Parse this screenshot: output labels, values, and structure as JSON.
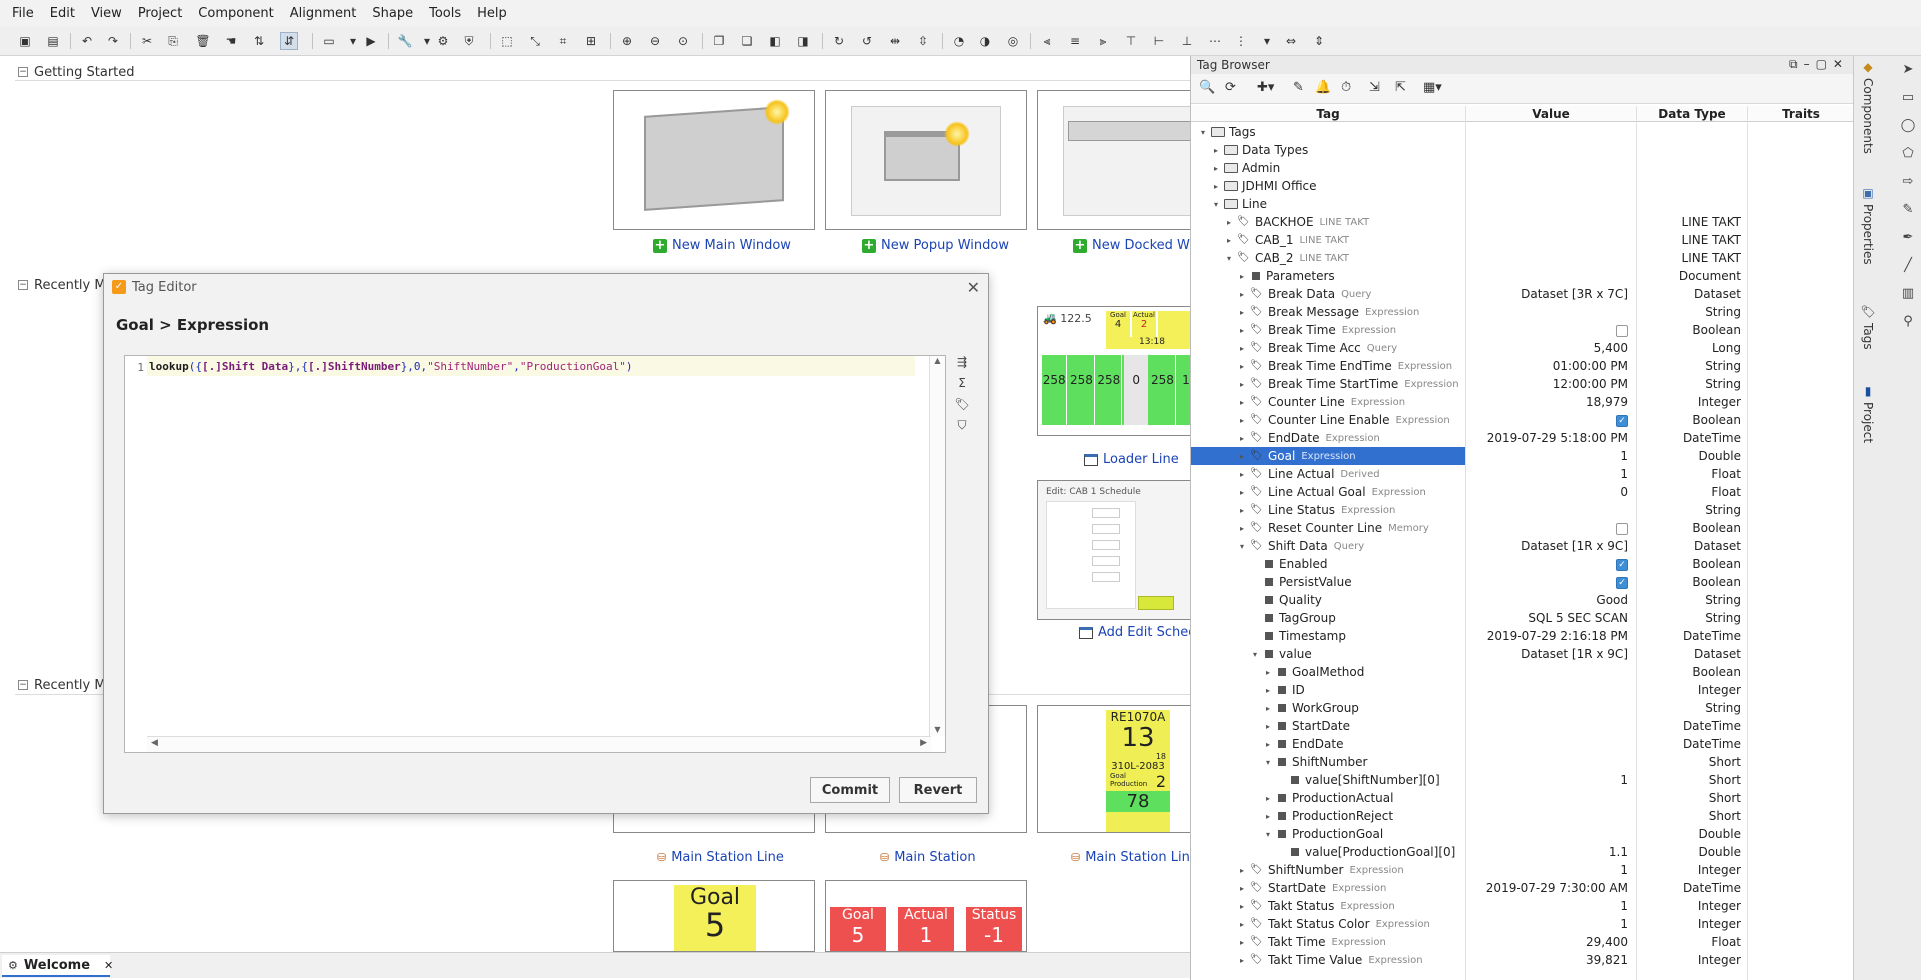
{
  "menu": [
    "File",
    "Edit",
    "View",
    "Project",
    "Component",
    "Alignment",
    "Shape",
    "Tools",
    "Help"
  ],
  "sections": {
    "getting_started": "Getting Started",
    "recently_modified_1": "Recently Mo",
    "recently_modified_2": "Recently Mo"
  },
  "cards": {
    "new_main_window": "New Main Window",
    "new_popup_window": "New Popup Window",
    "new_docked_window": "New Docked Windo",
    "loader_line": "Loader Line",
    "add_edit_schedule": "Add Edit Schedu",
    "main_station_line_1": "Main Station Line",
    "main_station": "Main Station",
    "main_station_line_2": "Main Station Line"
  },
  "thumbs": {
    "goal_label": "Goal",
    "goal_value": "5",
    "actual_label": "Actual",
    "actual_value": "1",
    "status_label": "Status",
    "status_value": "-1",
    "re_title": "RE1070A",
    "re_big": "13",
    "re_small": "18",
    "re_part": "310L-2083",
    "re_two": "2",
    "re_78": "78",
    "re_goal_caption": "Goal Production",
    "edit_schedule_title": "Edit: CAB 1 Schedule",
    "loader_goal": "Goal",
    "loader_actual": "Actual",
    "loader_four": "4",
    "loader_two": "2",
    "loader_clock": "13:18",
    "loader_1225": "122.5"
  },
  "dialog": {
    "title": "Tag Editor",
    "breadcrumb": "Goal > Expression",
    "line_no": "1",
    "code_fn": "lookup",
    "code_a": "({",
    "code_ref1": "[.]Shift Data",
    "code_b": "},{",
    "code_ref2": "[.]ShiftNumber",
    "code_c": "},0,",
    "code_s1": "\"ShiftNumber\"",
    "code_d": ",",
    "code_s2": "\"ProductionGoal\"",
    "code_e": ")",
    "commit": "Commit",
    "revert": "Revert"
  },
  "welcome_tab": "Welcome",
  "tag_browser": {
    "title": "Tag Browser",
    "columns": {
      "tag": "Tag",
      "value": "Value",
      "datatype": "Data Type",
      "traits": "Traits"
    },
    "rows": [
      {
        "indent": 0,
        "arrow": "▾",
        "icon": "folder",
        "name": "Tags",
        "sub": "",
        "value": "",
        "type": ""
      },
      {
        "indent": 1,
        "arrow": "▸",
        "icon": "folder",
        "name": "Data Types",
        "sub": "",
        "value": "",
        "type": ""
      },
      {
        "indent": 1,
        "arrow": "▸",
        "icon": "folder",
        "name": "Admin",
        "sub": "",
        "value": "",
        "type": ""
      },
      {
        "indent": 1,
        "arrow": "▸",
        "icon": "folder",
        "name": "JDHMI Office",
        "sub": "",
        "value": "",
        "type": ""
      },
      {
        "indent": 1,
        "arrow": "▾",
        "icon": "folder",
        "name": "Line",
        "sub": "",
        "value": "",
        "type": ""
      },
      {
        "indent": 2,
        "arrow": "▸",
        "icon": "tag",
        "name": "BACKHOE",
        "sub": "LINE TAKT",
        "value": "",
        "type": "LINE TAKT"
      },
      {
        "indent": 2,
        "arrow": "▸",
        "icon": "tag",
        "name": "CAB_1",
        "sub": "LINE TAKT",
        "value": "",
        "type": "LINE TAKT"
      },
      {
        "indent": 2,
        "arrow": "▾",
        "icon": "tag",
        "name": "CAB_2",
        "sub": "LINE TAKT",
        "value": "",
        "type": "LINE TAKT"
      },
      {
        "indent": 3,
        "arrow": "▸",
        "icon": "sq",
        "name": "Parameters",
        "sub": "",
        "value": "",
        "type": "Document"
      },
      {
        "indent": 3,
        "arrow": "▸",
        "icon": "tag",
        "name": "Break Data",
        "sub": "Query",
        "value": "Dataset [3R x 7C]",
        "type": "Dataset"
      },
      {
        "indent": 3,
        "arrow": "▸",
        "icon": "tag",
        "name": "Break Message",
        "sub": "Expression",
        "value": "",
        "type": "String"
      },
      {
        "indent": 3,
        "arrow": "▸",
        "icon": "tag",
        "name": "Break Time",
        "sub": "Expression",
        "value": "[chk-off]",
        "type": "Boolean"
      },
      {
        "indent": 3,
        "arrow": "▸",
        "icon": "tag",
        "name": "Break Time Acc",
        "sub": "Query",
        "value": "5,400",
        "type": "Long"
      },
      {
        "indent": 3,
        "arrow": "▸",
        "icon": "tag",
        "name": "Break Time EndTime",
        "sub": "Expression",
        "value": "01:00:00 PM",
        "type": "String"
      },
      {
        "indent": 3,
        "arrow": "▸",
        "icon": "tag",
        "name": "Break Time StartTime",
        "sub": "Expression",
        "value": "12:00:00 PM",
        "type": "String"
      },
      {
        "indent": 3,
        "arrow": "▸",
        "icon": "tag",
        "name": "Counter Line",
        "sub": "Expression",
        "value": "18,979",
        "type": "Integer"
      },
      {
        "indent": 3,
        "arrow": "▸",
        "icon": "tag",
        "name": "Counter Line Enable",
        "sub": "Expression",
        "value": "[chk-on]",
        "type": "Boolean"
      },
      {
        "indent": 3,
        "arrow": "▸",
        "icon": "tag",
        "name": "EndDate",
        "sub": "Expression",
        "value": "2019-07-29 5:18:00 PM",
        "type": "DateTime"
      },
      {
        "indent": 3,
        "arrow": "▸",
        "icon": "tag",
        "name": "Goal",
        "sub": "Expression",
        "value": "1",
        "type": "Double",
        "selected": true
      },
      {
        "indent": 3,
        "arrow": "▸",
        "icon": "tag",
        "name": "Line Actual",
        "sub": "Derived",
        "value": "1",
        "type": "Float"
      },
      {
        "indent": 3,
        "arrow": "▸",
        "icon": "tag",
        "name": "Line Actual Goal",
        "sub": "Expression",
        "value": "0",
        "type": "Float"
      },
      {
        "indent": 3,
        "arrow": "▸",
        "icon": "tag",
        "name": "Line Status",
        "sub": "Expression",
        "value": "",
        "type": "String"
      },
      {
        "indent": 3,
        "arrow": "▸",
        "icon": "tag",
        "name": "Reset Counter Line",
        "sub": "Memory",
        "value": "[chk-off]",
        "type": "Boolean"
      },
      {
        "indent": 3,
        "arrow": "▾",
        "icon": "tag",
        "name": "Shift Data",
        "sub": "Query",
        "value": "Dataset [1R x 9C]",
        "type": "Dataset"
      },
      {
        "indent": 4,
        "arrow": "",
        "icon": "sq",
        "name": "Enabled",
        "sub": "",
        "value": "[chk-on]",
        "type": "Boolean"
      },
      {
        "indent": 4,
        "arrow": "",
        "icon": "sq",
        "name": "PersistValue",
        "sub": "",
        "value": "[chk-on]",
        "type": "Boolean"
      },
      {
        "indent": 4,
        "arrow": "",
        "icon": "sq",
        "name": "Quality",
        "sub": "",
        "value": "Good",
        "type": "String"
      },
      {
        "indent": 4,
        "arrow": "",
        "icon": "sq",
        "name": "TagGroup",
        "sub": "",
        "value": "SQL 5 SEC SCAN",
        "type": "String"
      },
      {
        "indent": 4,
        "arrow": "",
        "icon": "sq",
        "name": "Timestamp",
        "sub": "",
        "value": "2019-07-29 2:16:18 PM",
        "type": "DateTime"
      },
      {
        "indent": 4,
        "arrow": "▾",
        "icon": "sq",
        "name": "value",
        "sub": "",
        "value": "Dataset [1R x 9C]",
        "type": "Dataset"
      },
      {
        "indent": 5,
        "arrow": "▸",
        "icon": "sq",
        "name": "GoalMethod",
        "sub": "",
        "value": "",
        "type": "Boolean"
      },
      {
        "indent": 5,
        "arrow": "▸",
        "icon": "sq",
        "name": "ID",
        "sub": "",
        "value": "",
        "type": "Integer"
      },
      {
        "indent": 5,
        "arrow": "▸",
        "icon": "sq",
        "name": "WorkGroup",
        "sub": "",
        "value": "",
        "type": "String"
      },
      {
        "indent": 5,
        "arrow": "▸",
        "icon": "sq",
        "name": "StartDate",
        "sub": "",
        "value": "",
        "type": "DateTime"
      },
      {
        "indent": 5,
        "arrow": "▸",
        "icon": "sq",
        "name": "EndDate",
        "sub": "",
        "value": "",
        "type": "DateTime"
      },
      {
        "indent": 5,
        "arrow": "▾",
        "icon": "sq",
        "name": "ShiftNumber",
        "sub": "",
        "value": "",
        "type": "Short"
      },
      {
        "indent": 6,
        "arrow": "",
        "icon": "sq",
        "name": "value[ShiftNumber][0]",
        "sub": "",
        "value": "1",
        "type": "Short"
      },
      {
        "indent": 5,
        "arrow": "▸",
        "icon": "sq",
        "name": "ProductionActual",
        "sub": "",
        "value": "",
        "type": "Short"
      },
      {
        "indent": 5,
        "arrow": "▸",
        "icon": "sq",
        "name": "ProductionReject",
        "sub": "",
        "value": "",
        "type": "Short"
      },
      {
        "indent": 5,
        "arrow": "▾",
        "icon": "sq",
        "name": "ProductionGoal",
        "sub": "",
        "value": "",
        "type": "Double"
      },
      {
        "indent": 6,
        "arrow": "",
        "icon": "sq",
        "name": "value[ProductionGoal][0]",
        "sub": "",
        "value": "1.1",
        "type": "Double"
      },
      {
        "indent": 3,
        "arrow": "▸",
        "icon": "tag",
        "name": "ShiftNumber",
        "sub": "Expression",
        "value": "1",
        "type": "Integer"
      },
      {
        "indent": 3,
        "arrow": "▸",
        "icon": "tag",
        "name": "StartDate",
        "sub": "Expression",
        "value": "2019-07-29 7:30:00 AM",
        "type": "DateTime"
      },
      {
        "indent": 3,
        "arrow": "▸",
        "icon": "tag",
        "name": "Takt Status",
        "sub": "Expression",
        "value": "1",
        "type": "Integer"
      },
      {
        "indent": 3,
        "arrow": "▸",
        "icon": "tag",
        "name": "Takt Status Color",
        "sub": "Expression",
        "value": "1",
        "type": "Integer"
      },
      {
        "indent": 3,
        "arrow": "▸",
        "icon": "tag",
        "name": "Takt Time",
        "sub": "Expression",
        "value": "29,400",
        "type": "Float"
      },
      {
        "indent": 3,
        "arrow": "▸",
        "icon": "tag",
        "name": "Takt Time Value",
        "sub": "Expression",
        "value": "39,821",
        "type": "Integer"
      }
    ]
  },
  "right_dock": {
    "components": "Components",
    "properties": "Properties",
    "tags": "Tags",
    "project": "Project"
  }
}
